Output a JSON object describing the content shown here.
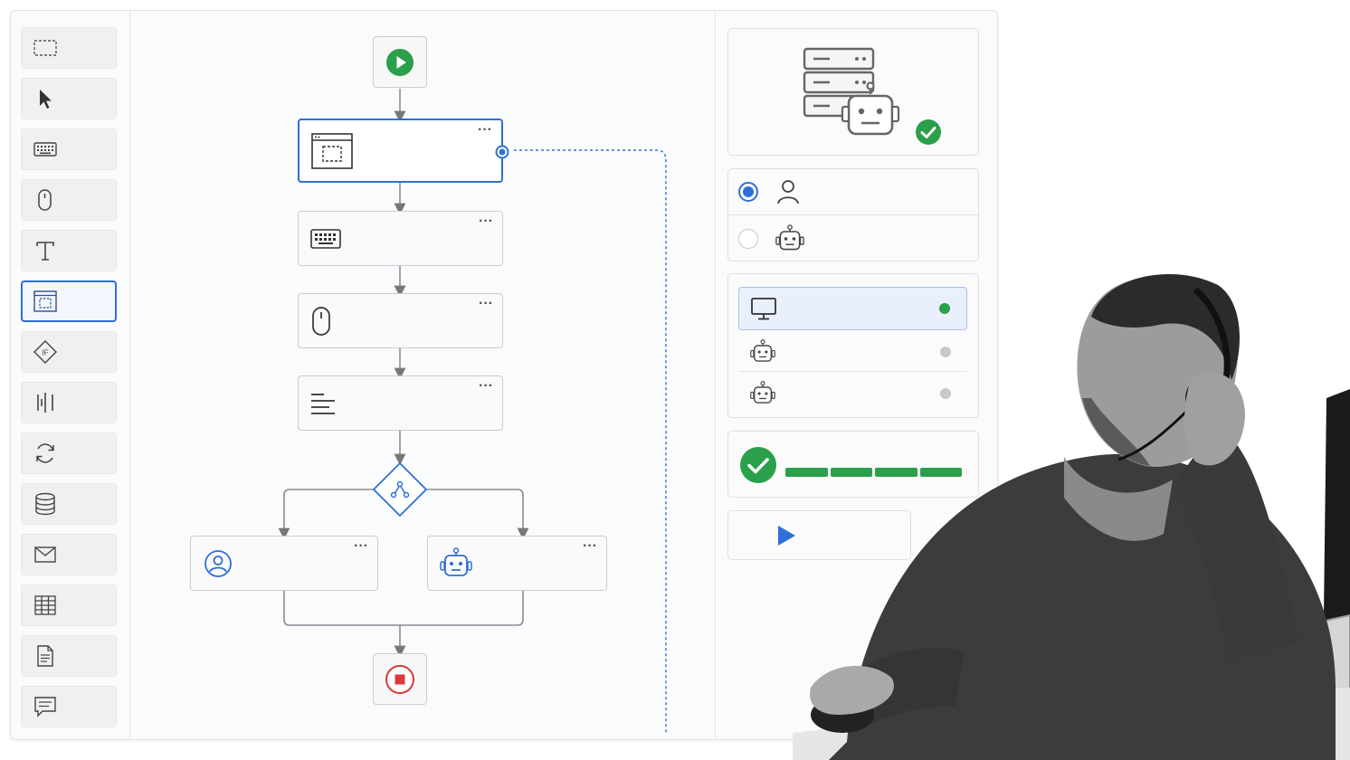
{
  "toolbox": {
    "items": [
      {
        "id": "select-region",
        "icon": "dashed-selection-icon"
      },
      {
        "id": "cursor",
        "icon": "pointer-icon"
      },
      {
        "id": "keyboard",
        "icon": "keyboard-icon"
      },
      {
        "id": "mouse",
        "icon": "mouse-icon"
      },
      {
        "id": "text",
        "icon": "text-icon"
      },
      {
        "id": "window-capture",
        "icon": "window-capture-icon",
        "active": true
      },
      {
        "id": "if-condition",
        "icon": "if-diamond-icon",
        "label": "IF"
      },
      {
        "id": "parallel",
        "icon": "parallel-bars-icon"
      },
      {
        "id": "loop",
        "icon": "refresh-icon"
      },
      {
        "id": "database",
        "icon": "database-icon"
      },
      {
        "id": "email",
        "icon": "envelope-icon"
      },
      {
        "id": "table",
        "icon": "table-icon"
      },
      {
        "id": "document",
        "icon": "document-icon"
      },
      {
        "id": "comment",
        "icon": "comment-icon"
      }
    ]
  },
  "flow": {
    "start": {
      "icon": "play-circle-icon"
    },
    "steps": [
      {
        "id": "window-capture",
        "icon": "window-capture-icon",
        "selected": true,
        "menu": "···"
      },
      {
        "id": "keyboard",
        "icon": "keyboard-icon",
        "menu": "···"
      },
      {
        "id": "mouse",
        "icon": "mouse-icon",
        "menu": "···"
      },
      {
        "id": "text-align",
        "icon": "text-lines-icon",
        "menu": "···"
      }
    ],
    "branch": {
      "icon": "branch-diamond-icon"
    },
    "human": {
      "icon": "user-circle-icon",
      "menu": "···"
    },
    "bot": {
      "icon": "robot-icon",
      "menu": "···"
    },
    "end": {
      "icon": "stop-circle-icon"
    }
  },
  "panel": {
    "header": {
      "icon": "server-robot-icon",
      "status": "check-icon"
    },
    "executor": {
      "options": [
        {
          "id": "human",
          "icon": "user-icon",
          "selected": true
        },
        {
          "id": "bot",
          "icon": "robot-icon",
          "selected": false
        }
      ]
    },
    "targets": [
      {
        "id": "desktop",
        "icon": "monitor-icon",
        "status": "online",
        "active": true
      },
      {
        "id": "bot-1",
        "icon": "robot-icon",
        "status": "idle",
        "active": false
      },
      {
        "id": "bot-2",
        "icon": "robot-icon",
        "status": "idle",
        "active": false
      }
    ],
    "progress": {
      "icon": "check-circle-icon",
      "value": 1.0,
      "segments": 4
    },
    "run": {
      "icon": "play-icon"
    }
  },
  "colors": {
    "accent": "#2f6fd6",
    "success": "#2aa04a",
    "stop": "#d93a3a",
    "idle": "#c5c8cc",
    "border": "#c9ccd1"
  }
}
